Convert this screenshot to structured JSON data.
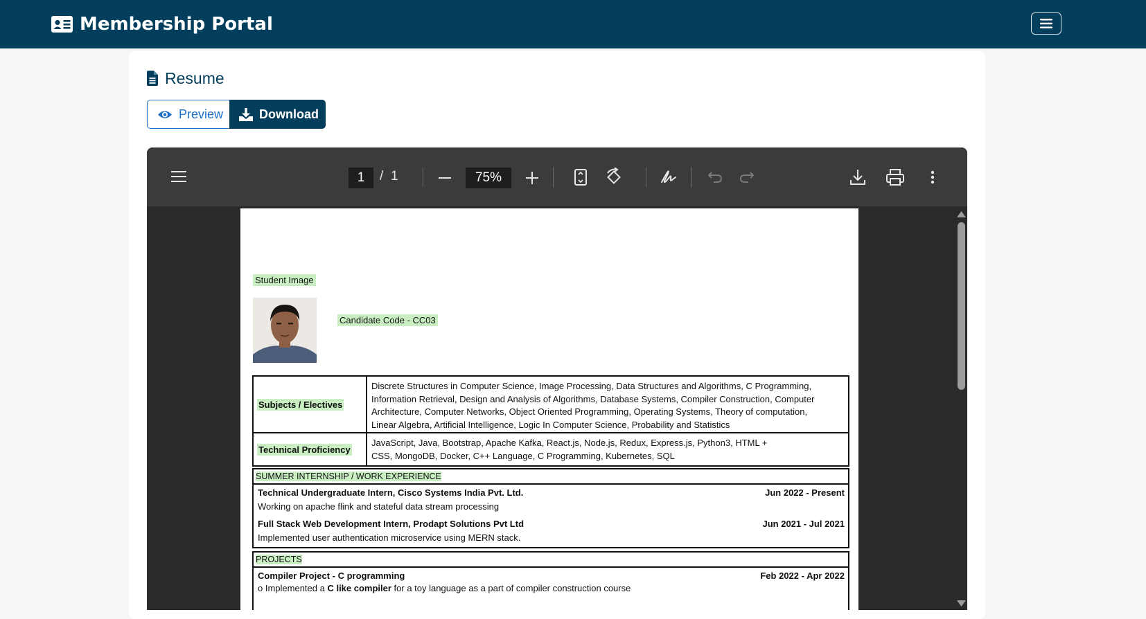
{
  "app": {
    "title": "Membership Portal"
  },
  "page": {
    "heading": "Resume",
    "preview_label": "Preview",
    "download_label": "Download"
  },
  "viewer": {
    "current_page": "1",
    "page_separator": "/",
    "total_pages": "1",
    "zoom": "75%"
  },
  "resume": {
    "student_image_label": "Student Image",
    "candidate_code": "Candidate Code - CC03",
    "subjects_label": "Subjects / Electives",
    "subjects_line1": "Discrete Structures in Computer Science,  Image Processing,  Data Structures and Algorithms,  C Programming,",
    "subjects_line2": " Information Retrieval,  Design and Analysis of Algorithms,  Database Systems,  Compiler Construction,  Computer",
    "subjects_line3": "Architecture,  Computer Networks,  Object Oriented Programming,  Operating Systems,  Theory of computation,",
    "subjects_line4": " Linear Algebra,  Artificial Intelligence,  Logic In Computer Science,  Probability and Statistics",
    "tech_label": "Technical Proficiency",
    "tech_line1": "JavaScript, Java, Bootstrap, Apache Kafka, React.js, Node.js, Redux, Express.js, Python3, HTML +",
    "tech_line2": "CSS, MongoDB, Docker, C++ Language, C Programming, Kubernetes, SQL",
    "experience_heading": "SUMMER INTERNSHIP / WORK EXPERIENCE",
    "experience": [
      {
        "title": "Technical Undergraduate Intern, Cisco Systems India Pvt. Ltd.",
        "dates": "Jun 2022 - Present",
        "desc": "Working on apache flink and stateful data stream processing"
      },
      {
        "title": "Full Stack Web Development Intern, Prodapt Solutions Pvt Ltd",
        "dates": "Jun 2021 - Jul 2021",
        "desc": "Implemented user authentication microservice using MERN stack."
      }
    ],
    "projects_heading": "PROJECTS",
    "projects": [
      {
        "title": "Compiler Project - C programming",
        "dates": "Feb 2022 - Apr 2022",
        "desc_prefix": "o   Implemented a ",
        "desc_bold": "C like compiler",
        "desc_suffix": " for a toy language as a part of compiler construction course"
      }
    ]
  }
}
